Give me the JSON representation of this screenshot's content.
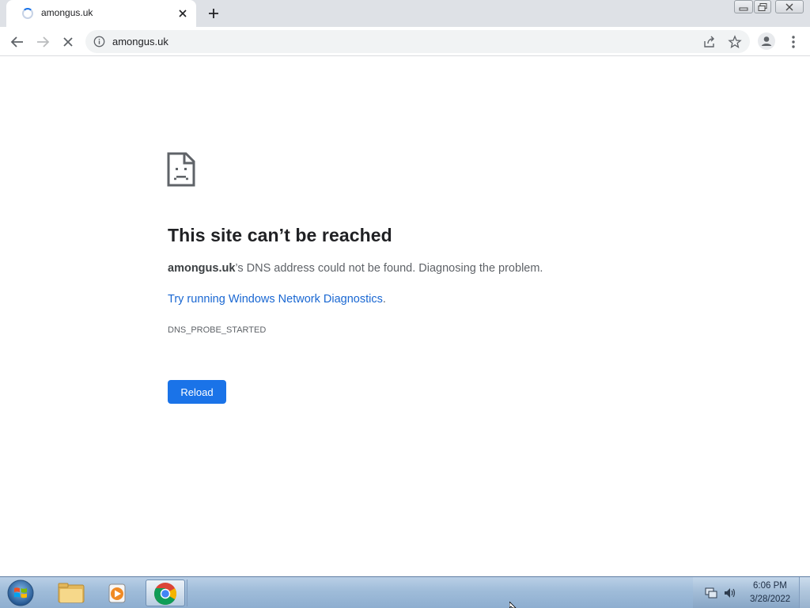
{
  "browser": {
    "tab": {
      "title": "amongus.uk",
      "close_icon": "close-icon"
    },
    "new_tab_icon": "plus-icon",
    "window_controls": [
      "minimize-icon",
      "restore-icon",
      "close-icon"
    ],
    "toolbar": {
      "back_icon": "arrow-left-icon",
      "forward_icon": "arrow-right-icon",
      "stop_icon": "x-icon",
      "url": "amongus.uk",
      "info_icon": "info-icon",
      "share_icon": "share-icon",
      "bookmark_icon": "star-icon",
      "profile_icon": "person-icon",
      "menu_icon": "kebab-menu-icon"
    }
  },
  "error_page": {
    "icon": "sad-document-icon",
    "title": "This site can’t be reached",
    "host": "amongus.uk",
    "description_rest": "’s DNS address could not be found. Diagnosing the problem.",
    "link_text": "Try running Windows Network Diagnostics",
    "link_suffix": ".",
    "error_code": "DNS_PROBE_STARTED",
    "reload_label": "Reload"
  },
  "taskbar": {
    "start_icon": "windows-start-orb-icon",
    "pinned": [
      "folder-icon",
      "media-player-icon",
      "chrome-icon"
    ],
    "tray_icons": [
      "network-icon",
      "volume-icon"
    ],
    "clock": {
      "time": "6:06 PM",
      "date": "3/28/2022"
    }
  },
  "colors": {
    "accent": "#1a73e8",
    "link": "#1967d2",
    "title_text": "#202124",
    "body_text": "#5f6368"
  }
}
